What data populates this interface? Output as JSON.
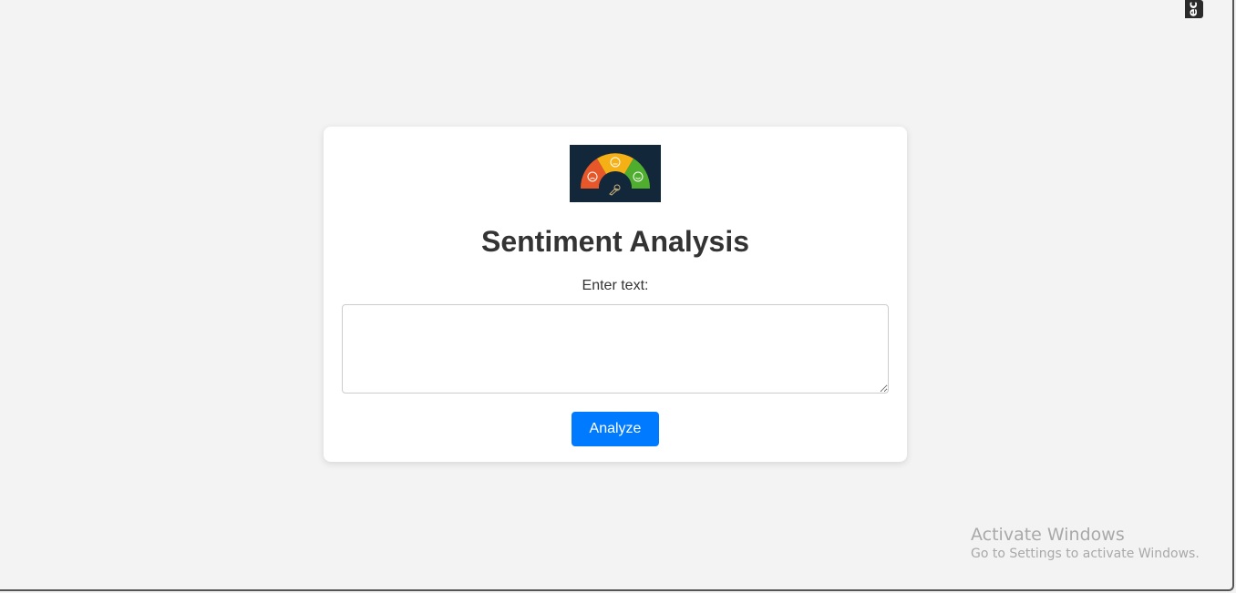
{
  "extension_badge": "ec",
  "card": {
    "logo_icon": "sentiment-gauge-icon",
    "title": "Sentiment Analysis",
    "input_label": "Enter text:",
    "input_value": "",
    "input_placeholder": "",
    "submit_label": "Analyze"
  },
  "colors": {
    "background": "#f3f3f3",
    "card": "#ffffff",
    "button": "#007bff",
    "title": "#333333",
    "gauge_negative": "#e8572a",
    "gauge_neutral": "#f5b016",
    "gauge_positive": "#4fae2e"
  },
  "os_watermark": {
    "title": "Activate Windows",
    "subtitle": "Go to Settings to activate Windows."
  }
}
